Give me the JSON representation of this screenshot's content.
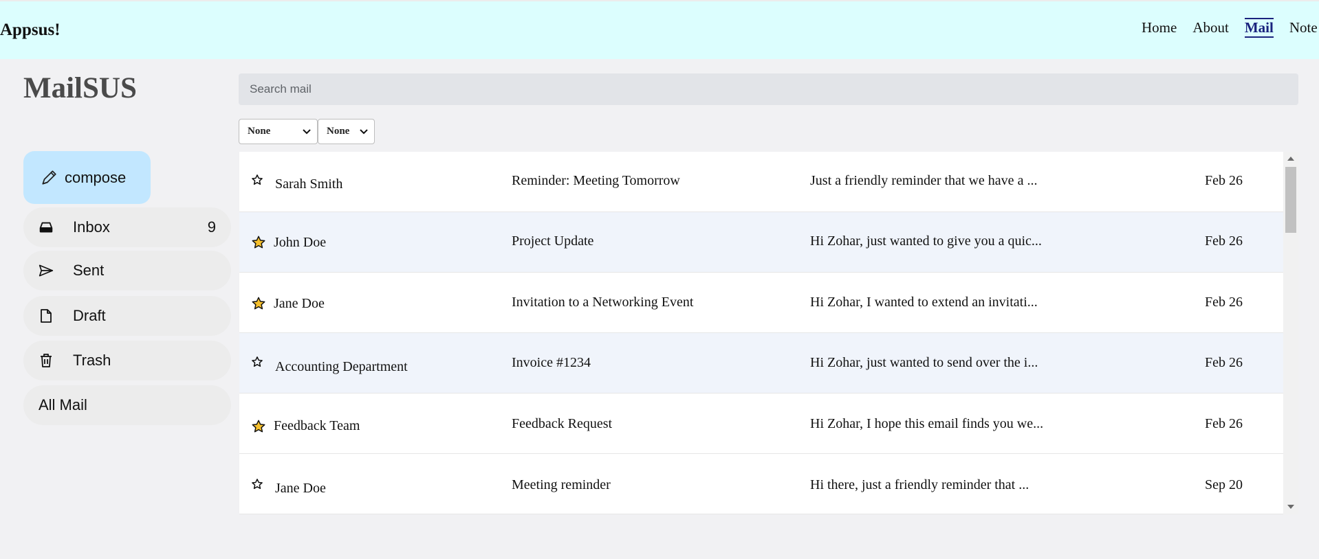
{
  "header": {
    "app_title": "Appsus!",
    "nav": [
      {
        "label": "Home",
        "active": false
      },
      {
        "label": "About",
        "active": false
      },
      {
        "label": "Mail",
        "active": true
      },
      {
        "label": "Note",
        "active": false
      }
    ]
  },
  "sidebar": {
    "brand": "MailSUS",
    "compose_label": "compose",
    "compose_icon": "pencil-icon",
    "items": [
      {
        "label": "Inbox",
        "icon": "inbox-icon",
        "count": "9"
      },
      {
        "label": "Sent",
        "icon": "send-icon",
        "count": ""
      },
      {
        "label": "Draft",
        "icon": "draft-file-icon",
        "count": ""
      },
      {
        "label": "Trash",
        "icon": "trash-icon",
        "count": ""
      },
      {
        "label": "All Mail",
        "icon": "",
        "count": ""
      }
    ]
  },
  "search": {
    "placeholder": "Search mail",
    "value": ""
  },
  "filters": [
    {
      "selected": "None"
    },
    {
      "selected": "None"
    }
  ],
  "emails": [
    {
      "sender": "Sarah Smith",
      "subject": "Reminder: Meeting Tomorrow",
      "preview": "Just a friendly reminder that we have a ...",
      "date": "Feb 26",
      "starred": false
    },
    {
      "sender": "John Doe",
      "subject": "Project Update",
      "preview": "Hi Zohar, just wanted to give you a quic...",
      "date": "Feb 26",
      "starred": true
    },
    {
      "sender": "Jane Doe",
      "subject": "Invitation to a Networking Event",
      "preview": "Hi Zohar, I wanted to extend an invitati...",
      "date": "Feb 26",
      "starred": true
    },
    {
      "sender": "Accounting Department",
      "subject": "Invoice #1234",
      "preview": "Hi Zohar, just wanted to send over the i...",
      "date": "Feb 26",
      "starred": false
    },
    {
      "sender": "Feedback Team",
      "subject": "Feedback Request",
      "preview": "Hi Zohar, I hope this email finds you we...",
      "date": "Feb 26",
      "starred": true
    },
    {
      "sender": "Jane Doe",
      "subject": "Meeting reminder",
      "preview": "Hi there, just a friendly reminder that ...",
      "date": "Sep 20",
      "starred": false
    }
  ],
  "colors": {
    "header_bg": "#dcfefe",
    "compose_bg": "#c2e7ff",
    "star_fill": "#f6c02d",
    "row_alt_bg": "#f0f4fb",
    "active_nav": "#1a237e"
  }
}
